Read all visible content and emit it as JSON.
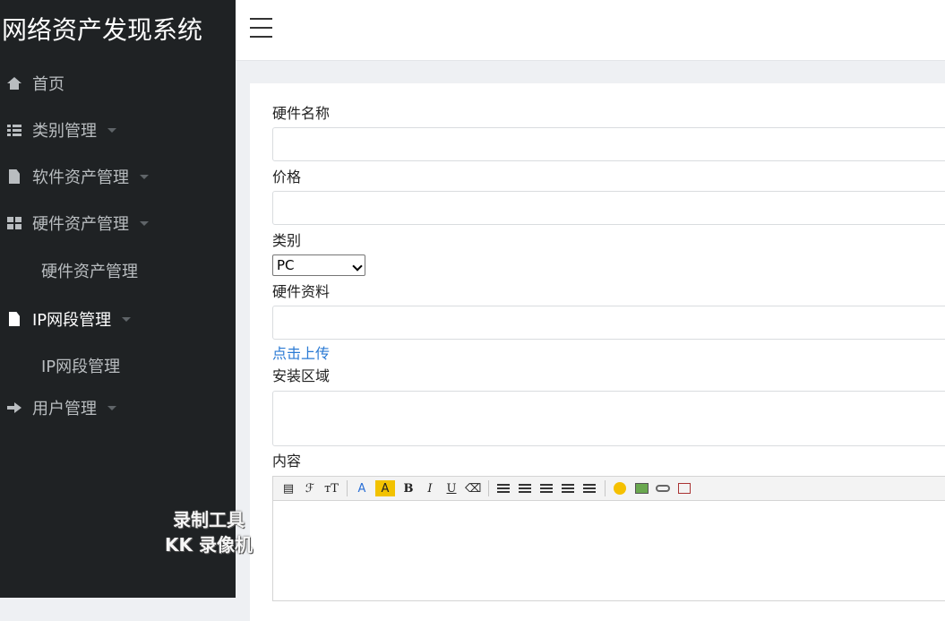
{
  "app": {
    "title": "网络资产发现系统"
  },
  "sidebar": {
    "items": [
      {
        "label": "首页",
        "icon": "home-icon"
      },
      {
        "label": "类别管理",
        "icon": "list-icon"
      },
      {
        "label": "软件资产管理",
        "icon": "file-icon"
      },
      {
        "label": "硬件资产管理",
        "icon": "grid-icon",
        "sub": "硬件资产管理"
      },
      {
        "label": "IP网段管理",
        "icon": "file-icon",
        "sub": "IP网段管理"
      },
      {
        "label": "用户管理",
        "icon": "arrow-right-icon"
      }
    ]
  },
  "form": {
    "name_label": "硬件名称",
    "name_value": "",
    "price_label": "价格",
    "price_value": "",
    "category_label": "类别",
    "category_selected": "PC",
    "material_label": "硬件资料",
    "material_value": "",
    "upload_label": "点击上传",
    "area_label": "安装区域",
    "area_value": "",
    "content_label": "内容"
  },
  "editor": {
    "toolbar": [
      "paste-icon",
      "font-family",
      "font-size",
      "font-color",
      "background-color",
      "bold",
      "italic",
      "underline",
      "eraser",
      "align-left",
      "align-center",
      "align-right",
      "ordered-list",
      "unordered-list",
      "emoji",
      "image",
      "link",
      "fullscreen"
    ],
    "bold": "B",
    "italic": "I",
    "underline": "U",
    "font_color": "A",
    "bg_color": "A",
    "font_family": "ℱ",
    "font_size": "ᴛT"
  },
  "watermark": {
    "line1": "录制工具",
    "line2": "KK 录像机"
  }
}
